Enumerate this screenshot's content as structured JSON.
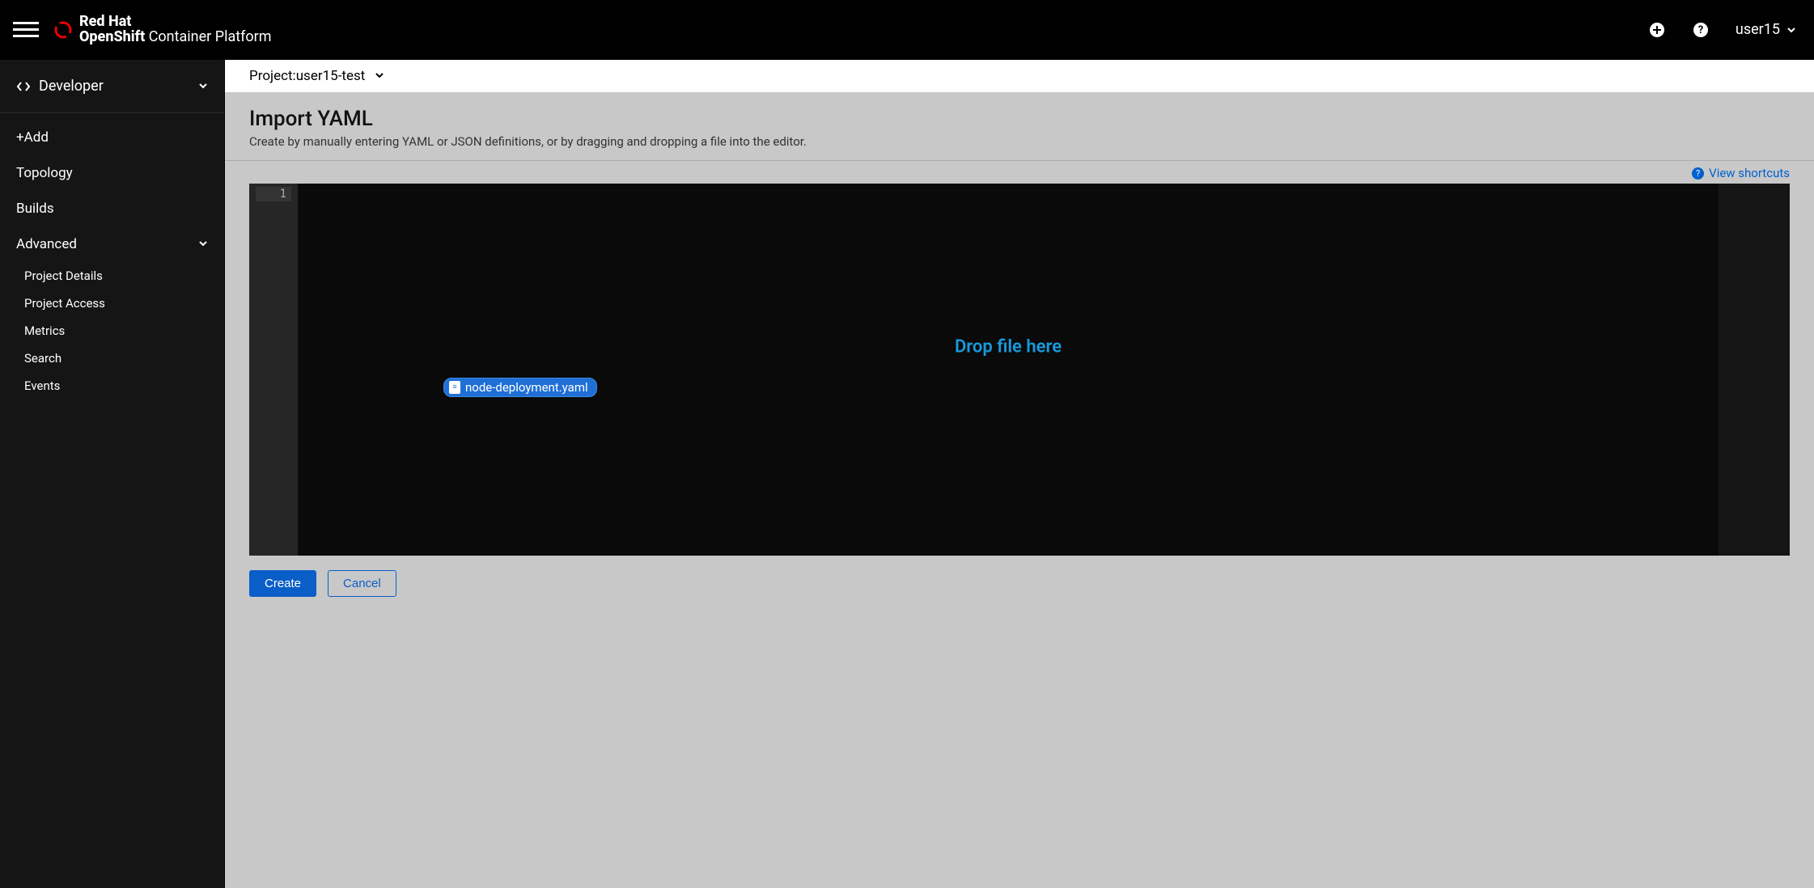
{
  "header": {
    "brand_line1": "Red Hat",
    "brand_line2_bold": "OpenShift",
    "brand_line2_rest": " Container Platform",
    "username": "user15"
  },
  "sidebar": {
    "perspective_label": "Developer",
    "items": [
      {
        "label": "+Add"
      },
      {
        "label": "Topology"
      },
      {
        "label": "Builds"
      },
      {
        "label": "Advanced",
        "expandable": true,
        "expanded": true
      }
    ],
    "advanced_sub": [
      {
        "label": "Project Details"
      },
      {
        "label": "Project Access"
      },
      {
        "label": "Metrics"
      },
      {
        "label": "Search"
      },
      {
        "label": "Events"
      }
    ]
  },
  "project": {
    "prefix": "Project: ",
    "name": "user15-test"
  },
  "page": {
    "title": "Import YAML",
    "subtitle": "Create by manually entering YAML or JSON definitions, or by dragging and dropping a file into the editor.",
    "view_shortcuts": "View shortcuts"
  },
  "editor": {
    "first_line_number": "1",
    "drop_label": "Drop file here",
    "dragged_file": "node-deployment.yaml"
  },
  "actions": {
    "create": "Create",
    "cancel": "Cancel"
  }
}
